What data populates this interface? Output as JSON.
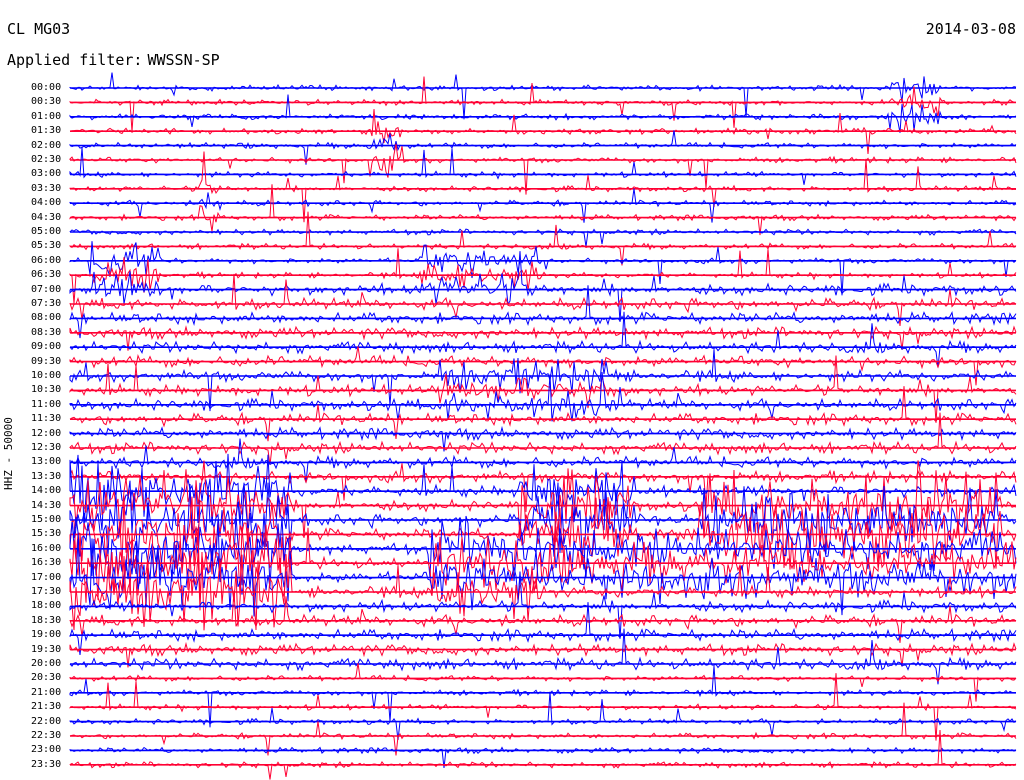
{
  "header": {
    "station": "CL MG03",
    "date": "2014-03-08",
    "filter_label": "Applied filter:",
    "filter_value": "WWSSN-SP"
  },
  "axis_label": "HHZ - 50000",
  "colors": {
    "even_trace": "#0000ff",
    "odd_trace": "#ff0033",
    "background": "#ffffff"
  },
  "chart_data": {
    "type": "line",
    "title": "CL MG03",
    "subtitle": "Applied filter: WWSSN-SP",
    "ylabel": "HHZ - 50000",
    "row_interval_minutes": 30,
    "tick_labels": [
      "00:00",
      "00:30",
      "01:00",
      "01:30",
      "02:00",
      "02:30",
      "03:00",
      "03:30",
      "04:00",
      "04:30",
      "05:00",
      "05:30",
      "06:00",
      "06:30",
      "07:00",
      "07:30",
      "08:00",
      "08:30",
      "09:00",
      "09:30",
      "10:00",
      "10:30",
      "11:00",
      "11:30",
      "12:00",
      "12:30",
      "13:00",
      "13:30",
      "14:00",
      "14:30",
      "15:00",
      "15:30",
      "16:00",
      "16:30",
      "17:00",
      "17:30",
      "18:00",
      "18:30",
      "19:00",
      "19:30",
      "20:00",
      "20:30",
      "21:00",
      "21:30",
      "22:00",
      "22:30",
      "23:00",
      "23:30"
    ],
    "series": [
      {
        "color": "#0000ff",
        "rows": "even"
      },
      {
        "color": "#ff0033",
        "rows": "odd"
      }
    ],
    "grid": false
  }
}
